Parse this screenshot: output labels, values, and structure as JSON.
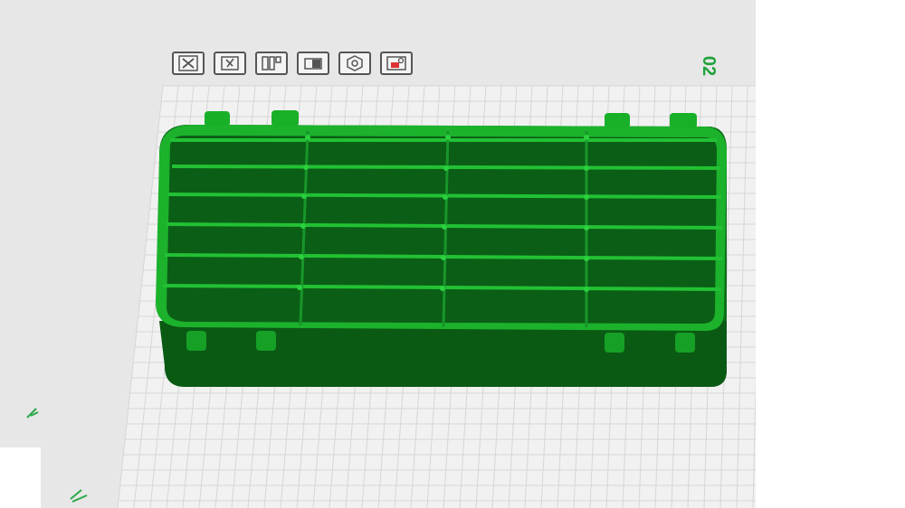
{
  "app": {
    "view_label": "02"
  },
  "toolbar": {
    "buttons": [
      {
        "name": "close-view",
        "icon": "x-box-icon"
      },
      {
        "name": "select-object",
        "icon": "pointer-box-icon"
      },
      {
        "name": "layout",
        "icon": "layout-grid-icon"
      },
      {
        "name": "place-on-face",
        "icon": "lay-flat-icon"
      },
      {
        "name": "settings",
        "icon": "hex-nut-icon"
      },
      {
        "name": "slice-preview",
        "icon": "printer-preview-icon"
      }
    ]
  },
  "colors": {
    "viewport_bg": "#e7e7e7",
    "grid_plate": "#f1f1f1",
    "grid_line": "#d6d6d6",
    "model_top": "#18b028",
    "model_dark": "#0a5a14",
    "model_wall": "#0d6e1a",
    "label_green": "#1fa23a"
  }
}
